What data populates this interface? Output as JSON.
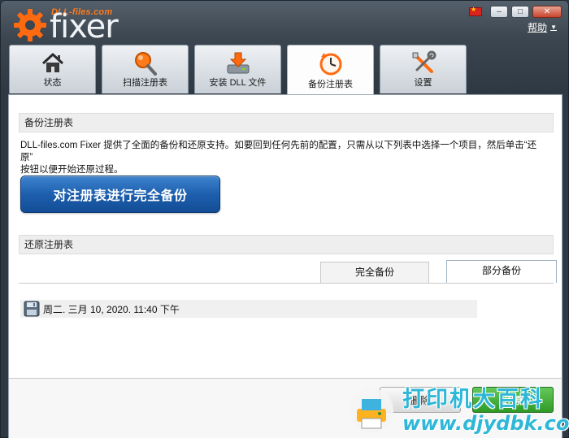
{
  "app": {
    "brand_small": "DLL-files.com",
    "brand_main": "fixer",
    "help_label": "帮助"
  },
  "colors": {
    "accent_orange": "#ff7a1a",
    "primary_blue": "#1d5fae",
    "restore_green": "#2f9a26",
    "watermark_cyan": "#2fb7d8"
  },
  "tabs": [
    {
      "label": "状态",
      "icon": "home-icon"
    },
    {
      "label": "扫描注册表",
      "icon": "magnifier-icon"
    },
    {
      "label": "安装 DLL 文件",
      "icon": "download-drive-icon"
    },
    {
      "label": "备份注册表",
      "icon": "clock-backup-icon",
      "active": true
    },
    {
      "label": "设置",
      "icon": "tools-icon"
    }
  ],
  "backup_section": {
    "title": "备份注册表",
    "description_line1": "DLL-files.com Fixer 提供了全面的备份和还原支持。如要回到任何先前的配置，只需从以下列表中选择一个项目，然后单击“还原”",
    "description_line2": "按钮以便开始还原过程。",
    "full_backup_button": "对注册表进行完全备份"
  },
  "restore_section": {
    "title": "还原注册表",
    "subtabs": [
      "完全备份",
      "部分备份"
    ],
    "active_subtab": "部分备份",
    "items": [
      {
        "label": "周二. 三月 10, 2020. 11:40 下午",
        "icon": "floppy-disk-icon"
      }
    ]
  },
  "actions": {
    "delete_label": "删除",
    "restore_label": "还原"
  },
  "watermark": {
    "line1": "打印机大百科",
    "line2": "www.djydbk.com"
  }
}
